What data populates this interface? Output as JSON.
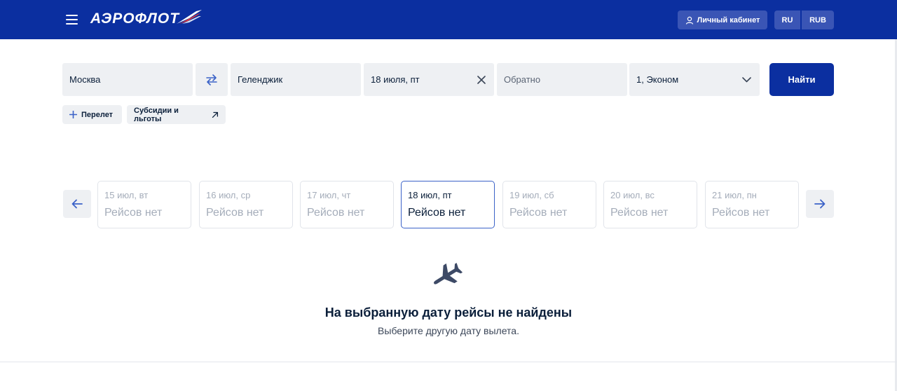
{
  "header": {
    "logo_text": "АЭРОФЛОТ",
    "cabinet_label": "Личный кабинет",
    "lang_label": "RU",
    "currency_label": "RUB"
  },
  "search": {
    "from": "Москва",
    "to": "Геленджик",
    "date": "18 июля, пт",
    "return_placeholder": "Обратно",
    "passengers": "1, Эконом",
    "find_label": "Найти",
    "add_flight_label": "Перелет",
    "subsidies_label": "Субсидии и льготы"
  },
  "days": [
    {
      "date": "15 июл, вт",
      "status": "Рейсов нет",
      "active": false
    },
    {
      "date": "16 июл, ср",
      "status": "Рейсов нет",
      "active": false
    },
    {
      "date": "17 июл, чт",
      "status": "Рейсов нет",
      "active": false
    },
    {
      "date": "18 июл, пт",
      "status": "Рейсов нет",
      "active": true
    },
    {
      "date": "19 июл, сб",
      "status": "Рейсов нет",
      "active": false
    },
    {
      "date": "20 июл, вс",
      "status": "Рейсов нет",
      "active": false
    },
    {
      "date": "21 июл, пн",
      "status": "Рейсов нет",
      "active": false
    }
  ],
  "empty_state": {
    "title": "На выбранную дату рейсы не найдены",
    "subtitle": "Выберите другую дату вылета."
  },
  "icons": {
    "menu": "menu-icon",
    "user": "user-icon",
    "swap": "swap-icon",
    "clear": "close-icon",
    "dropdown": "chevron-down-icon",
    "plus": "plus-icon",
    "external": "arrow-up-right-icon",
    "prev": "arrow-left-icon",
    "next": "arrow-right-icon",
    "plane": "plane-icon"
  },
  "colors": {
    "brand": "#0b2fa0",
    "active_border": "#3b62c8",
    "muted_text": "#a5adba"
  }
}
